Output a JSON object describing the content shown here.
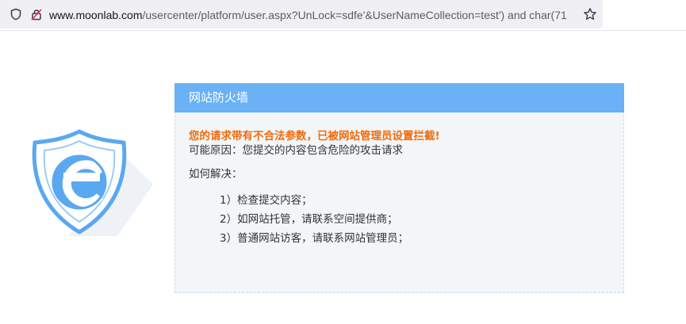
{
  "browser": {
    "url_host": "www.moonlab.com",
    "url_rest": "/usercenter/platform/user.aspx?UnLock=sdfe'&UserNameCollection=test') and char(71",
    "icons": {
      "site_info": "shield-icon",
      "permissions": "lock-icon",
      "bookmark": "star-icon"
    }
  },
  "panel": {
    "title": "网站防火墙",
    "block_message": "您的请求带有不合法参数，已被网站管理员设置拦截!",
    "reason": "可能原因：您提交的内容包含危险的攻击请求",
    "howto_title": "如何解决：",
    "steps": [
      "1）检查提交内容；",
      "2）如网站托管，请联系空间提供商；",
      "3）普通网站访客，请联系网站管理员；"
    ]
  },
  "colors": {
    "header": "#6ab1f5",
    "warning": "#f06a0a",
    "panel_bg": "#f2f6f9",
    "logo_blue": "#5aa8f0"
  },
  "logo": {
    "icon": "shield-e-logo"
  }
}
